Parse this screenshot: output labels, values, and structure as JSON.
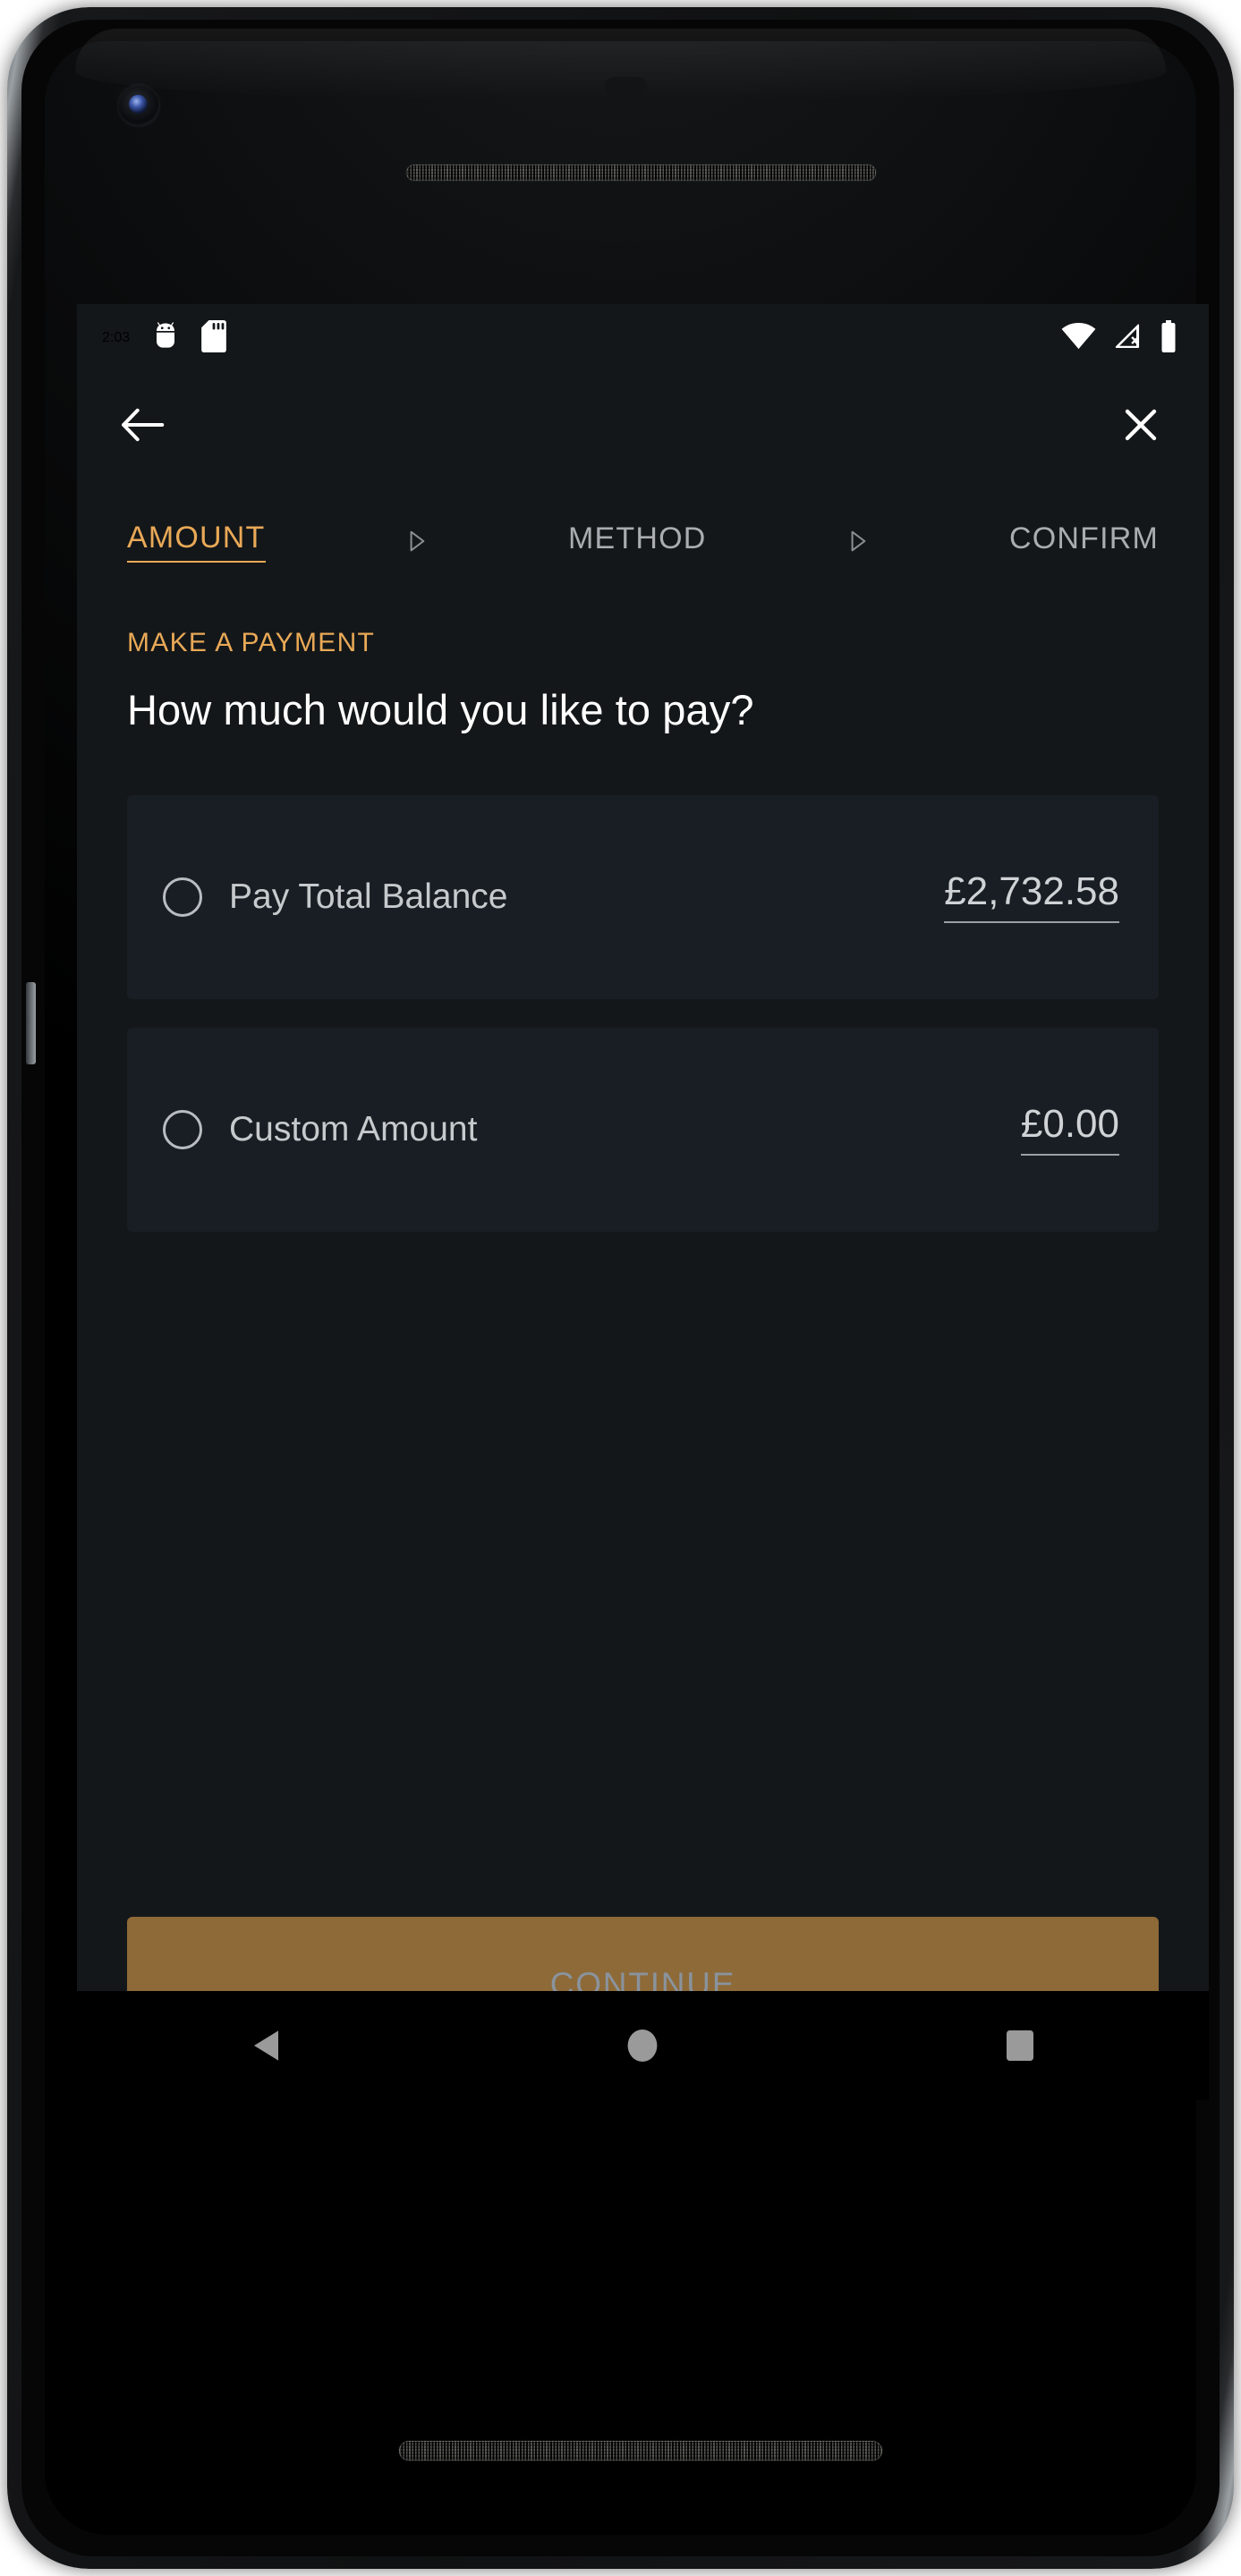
{
  "device": {
    "camera_icon": "front-camera-icon",
    "earpiece_icon": "earpiece-speaker-grille",
    "bottom_speaker_icon": "bottom-speaker-grille",
    "proximity_icon": "proximity-sensor-icon"
  },
  "status_bar": {
    "time": "2:03",
    "left_icons": [
      {
        "name": "android-debug-icon"
      },
      {
        "name": "sd-card-icon"
      }
    ],
    "right_icons": [
      {
        "name": "wifi-icon",
        "level": "full"
      },
      {
        "name": "cellular-no-signal-icon",
        "level": "none"
      },
      {
        "name": "battery-icon",
        "level": "full"
      }
    ]
  },
  "app_bar": {
    "back_icon": "back-arrow-icon",
    "close_icon": "close-icon"
  },
  "stepper": {
    "steps": [
      {
        "label": "AMOUNT",
        "active": true
      },
      {
        "label": "METHOD",
        "active": false
      },
      {
        "label": "CONFIRM",
        "active": false
      }
    ],
    "separator_icon": "triangle-right-icon"
  },
  "content": {
    "eyebrow": "MAKE A PAYMENT",
    "headline": "How much would you like to pay?",
    "options": [
      {
        "label": "Pay Total Balance",
        "amount": "£2,732.58",
        "selected": false,
        "radio_icon": "radio-unselected-icon"
      },
      {
        "label": "Custom Amount",
        "amount": "£0.00",
        "selected": false,
        "radio_icon": "radio-unselected-icon"
      }
    ]
  },
  "footer": {
    "continue_label": "CONTINUE",
    "continue_enabled": false
  },
  "nav_bar": {
    "back_icon": "nav-back-triangle-icon",
    "home_icon": "nav-home-circle-icon",
    "recents_icon": "nav-recents-square-icon"
  },
  "colors": {
    "accent_orange": "#E9A957",
    "screen_background": "#141719",
    "card_background": "#191E24",
    "button_background": "#8D6A38",
    "button_text_disabled": "#8A939D",
    "text_primary": "#FFFFFF",
    "text_secondary": "#C6CACD",
    "text_muted": "#A9ADB1"
  }
}
